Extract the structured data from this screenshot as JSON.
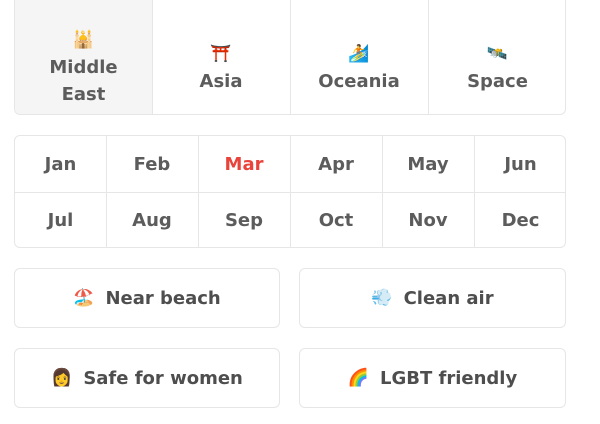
{
  "regions": [
    {
      "label": "Middle East",
      "icon": "🕌",
      "icon_name": "mosque-icon",
      "selected": true
    },
    {
      "label": "Asia",
      "icon": "⛩️",
      "icon_name": "torii-gate-icon",
      "selected": false
    },
    {
      "label": "Oceania",
      "icon": "🏄",
      "icon_name": "surfer-icon",
      "selected": false
    },
    {
      "label": "Space",
      "icon": "🛰️",
      "icon_name": "satellite-icon",
      "selected": false
    }
  ],
  "months": {
    "row1": [
      "Jan",
      "Feb",
      "Mar",
      "Apr",
      "May",
      "Jun"
    ],
    "row2": [
      "Jul",
      "Aug",
      "Sep",
      "Oct",
      "Nov",
      "Dec"
    ],
    "active": "Mar",
    "active_color": "#e9443b"
  },
  "filters": {
    "beach": {
      "label": "Near beach",
      "icon": "🏖️",
      "icon_name": "beach-umbrella-icon"
    },
    "air": {
      "label": "Clean air",
      "icon": "💨",
      "icon_name": "wind-icon"
    },
    "women": {
      "label": "Safe for women",
      "icon": "👩",
      "icon_name": "woman-icon"
    },
    "lgbt": {
      "label": "LGBT friendly",
      "icon": "🌈",
      "icon_name": "rainbow-icon"
    }
  }
}
